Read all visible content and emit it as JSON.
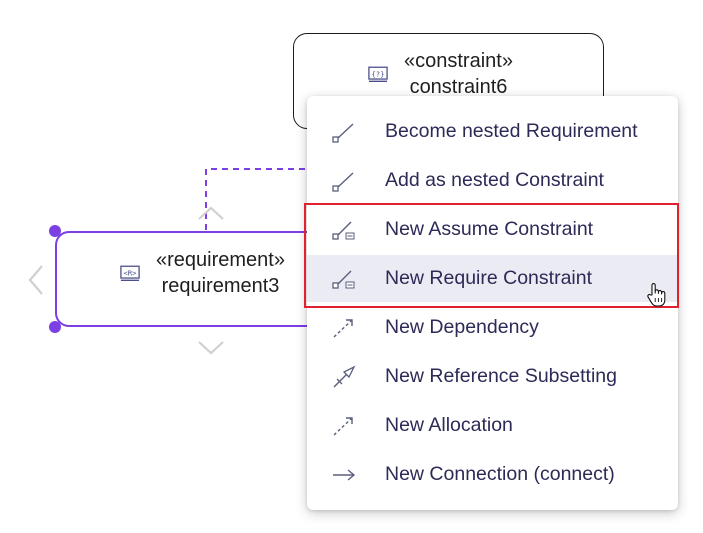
{
  "canvas": {
    "constraint_node": {
      "stereotype": "«constraint»",
      "name": "constraint6",
      "icon": "constraint-icon"
    },
    "requirement_node": {
      "stereotype": "«requirement»",
      "name": "requirement3",
      "icon": "requirement-icon",
      "selected": true
    }
  },
  "context_menu": {
    "items": [
      {
        "label": "Become nested Requirement",
        "icon": "nested-edge-icon"
      },
      {
        "label": "Add as nested Constraint",
        "icon": "nested-edge-icon"
      },
      {
        "label": "New Assume Constraint",
        "icon": "constraint-edge-icon"
      },
      {
        "label": "New Require Constraint",
        "icon": "constraint-edge-icon",
        "hovered": true
      },
      {
        "label": "New Dependency",
        "icon": "dashed-arrow-icon"
      },
      {
        "label": "New Reference Subsetting",
        "icon": "reference-subsetting-icon"
      },
      {
        "label": "New Allocation",
        "icon": "dashed-arrow-icon"
      },
      {
        "label": "New Connection (connect)",
        "icon": "connection-arrow-icon"
      }
    ]
  },
  "colors": {
    "selection": "#7b3fe4",
    "menu_text": "#2c2a57",
    "menu_hover": "#ebebf3",
    "highlight": "#e0212f",
    "icon": "#5a5f7d"
  }
}
